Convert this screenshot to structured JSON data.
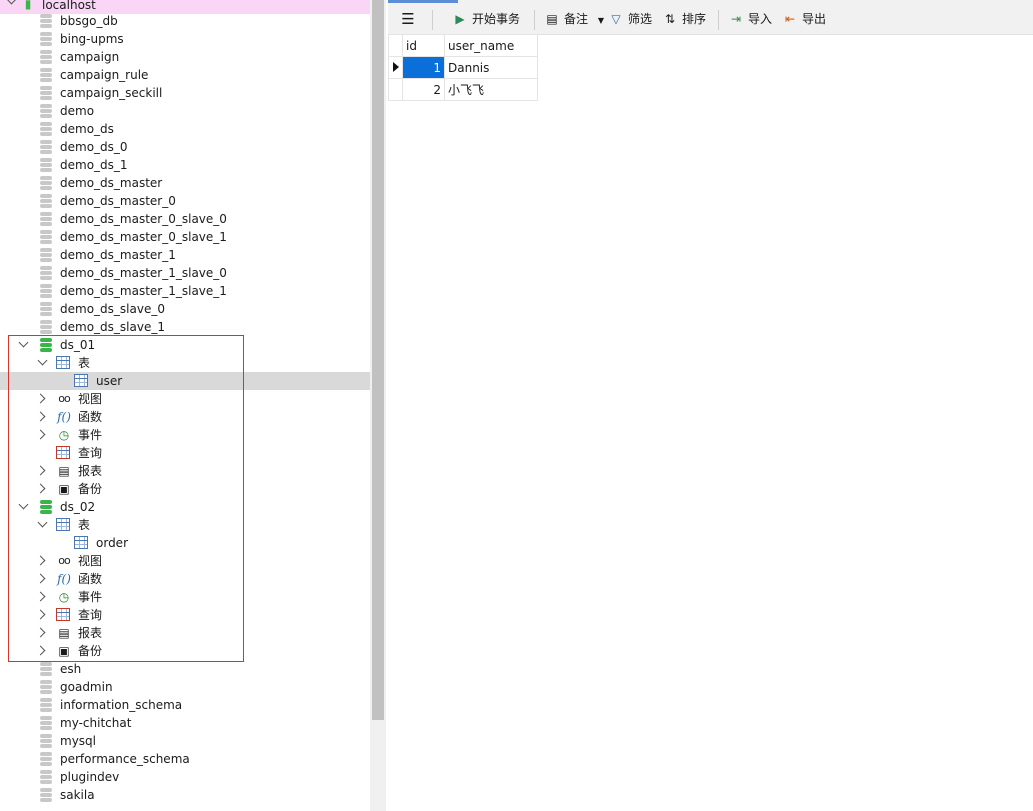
{
  "navigator": {
    "connection": "localhost",
    "databases_top": [
      "bbsgo_db",
      "bing-upms",
      "campaign",
      "campaign_rule",
      "campaign_seckill",
      "demo",
      "demo_ds",
      "demo_ds_0",
      "demo_ds_1",
      "demo_ds_master",
      "demo_ds_master_0",
      "demo_ds_master_0_slave_0",
      "demo_ds_master_0_slave_1",
      "demo_ds_master_1",
      "demo_ds_master_1_slave_0",
      "demo_ds_master_1_slave_1",
      "demo_ds_slave_0",
      "demo_ds_slave_1"
    ],
    "ds_01": {
      "name": "ds_01",
      "tables_label": "表",
      "table": "user",
      "views": "视图",
      "functions": "函数",
      "events": "事件",
      "queries": "查询",
      "reports": "报表",
      "backups": "备份"
    },
    "ds_02": {
      "name": "ds_02",
      "tables_label": "表",
      "table": "order",
      "views": "视图",
      "functions": "函数",
      "events": "事件",
      "queries": "查询",
      "reports": "报表",
      "backups": "备份"
    },
    "databases_bottom": [
      "esh",
      "goadmin",
      "information_schema",
      "my-chitchat",
      "mysql",
      "performance_schema",
      "plugindev",
      "sakila"
    ]
  },
  "toolbar": {
    "begin_transaction": "开始事务",
    "memo": "备注",
    "filter": "筛选",
    "sort": "排序",
    "import": "导入",
    "export": "导出"
  },
  "grid": {
    "columns": [
      "id",
      "user_name"
    ],
    "rows": [
      {
        "id": "1",
        "user_name": "Dannis"
      },
      {
        "id": "2",
        "user_name": "小飞飞"
      }
    ]
  },
  "colors": {
    "selection": "#0b6fd9",
    "highlight_box": "#d9342b",
    "connection_bg": "#f9d6f5",
    "db_active": "#39b54a"
  }
}
